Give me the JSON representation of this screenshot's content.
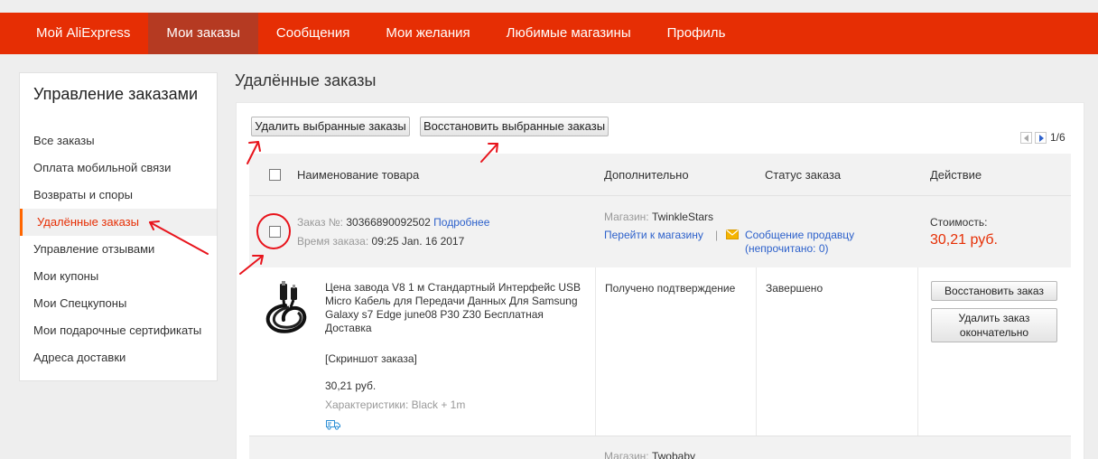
{
  "nav": {
    "items": [
      {
        "label": "Мой AliExpress"
      },
      {
        "label": "Мои заказы"
      },
      {
        "label": "Сообщения"
      },
      {
        "label": "Мои желания"
      },
      {
        "label": "Любимые магазины"
      },
      {
        "label": "Профиль"
      }
    ]
  },
  "sidebar": {
    "title": "Управление заказами",
    "items": [
      {
        "label": "Все заказы"
      },
      {
        "label": "Оплата мобильной связи"
      },
      {
        "label": "Возвраты и споры"
      },
      {
        "label": "Удалённые заказы"
      },
      {
        "label": "Управление отзывами"
      },
      {
        "label": "Мои купоны"
      },
      {
        "label": "Мои Спецкупоны"
      },
      {
        "label": "Мои подарочные сертификаты"
      },
      {
        "label": "Адреса доставки"
      }
    ]
  },
  "page": {
    "title": "Удалённые заказы"
  },
  "toolbar": {
    "delete_selected": "Удалить выбранные заказы",
    "restore_selected": "Восстановить выбранные заказы"
  },
  "pager": {
    "text": "1/6"
  },
  "table": {
    "headers": {
      "product": "Наименование товара",
      "extra": "Дополнительно",
      "status": "Статус заказа",
      "action": "Действие"
    }
  },
  "orders": [
    {
      "number_label": "Заказ №:",
      "number": "30366890092502",
      "details_link": "Подробнее",
      "time_label": "Время заказа:",
      "time": "09:25 Jan. 16 2017",
      "store_label": "Магазин:",
      "store": "TwinkleStars",
      "go_to_store": "Перейти к магазину",
      "separator": "|",
      "message_seller": "Сообщение продавцу",
      "unread_open": "(непрочитано:",
      "unread_count": "0",
      "unread_close": ")",
      "cost_label": "Стоимость:",
      "cost": "30,21 руб.",
      "product": {
        "title_lines": [
          "Цена завода V8 1 м Стандартный Интерфейс USB",
          "Micro Кабель для Передачи Данных Для Samsung",
          "Galaxy s7 Edge june08 P30 Z30 Бесплатная",
          "Доставка"
        ],
        "screenshot_link": "[Скриншот заказа]",
        "price": "30,21 руб.",
        "specs_label": "Характеристики:",
        "specs": "Black + 1m"
      },
      "extra_status": "Получено подтверждение",
      "status": "Завершено",
      "restore_button": "Восстановить заказ",
      "delete_button_lines": [
        "Удалить заказ",
        "окончательно"
      ]
    },
    {
      "store_label": "Магазин:",
      "store": "Twobaby"
    }
  ],
  "colors": {
    "brand_red": "#e62e04",
    "nav_active": "#b53a22",
    "link_blue": "#2d61cb",
    "annotation_red": "#e8141c"
  }
}
